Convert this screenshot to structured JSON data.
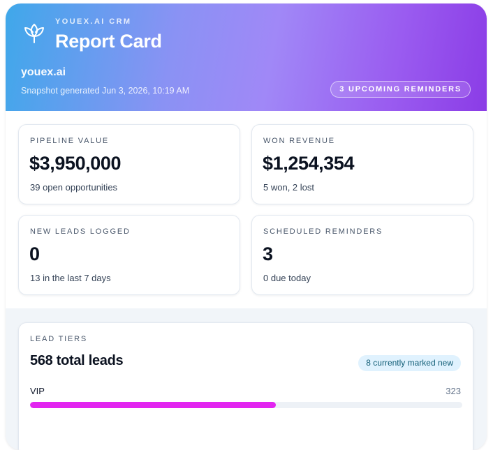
{
  "header": {
    "eyebrow": "YOUEX.AI CRM",
    "title": "Report Card",
    "org_name": "youex.ai",
    "snapshot": "Snapshot generated Jun 3, 2026, 10:19 AM",
    "reminders_pill": "3 UPCOMING REMINDERS",
    "logo_icon": "tulip-icon"
  },
  "stats": [
    {
      "label": "PIPELINE VALUE",
      "value": "$3,950,000",
      "sub": "39 open opportunities"
    },
    {
      "label": "WON REVENUE",
      "value": "$1,254,354",
      "sub": "5 won, 2 lost"
    },
    {
      "label": "NEW LEADS LOGGED",
      "value": "0",
      "sub": "13 in the last 7 days"
    },
    {
      "label": "SCHEDULED REMINDERS",
      "value": "3",
      "sub": "0 due today"
    }
  ],
  "lead_tiers": {
    "eyebrow": "LEAD TIERS",
    "total": "568 total leads",
    "new_badge": "8 currently marked new",
    "tiers": [
      {
        "name": "VIP",
        "count": "323",
        "fraction": 0.569,
        "color": "#e225f0"
      }
    ]
  },
  "colors": {
    "gradient_start": "#3fa8ea",
    "gradient_end": "#8b3ce6",
    "vip_bar": "#e225f0"
  }
}
